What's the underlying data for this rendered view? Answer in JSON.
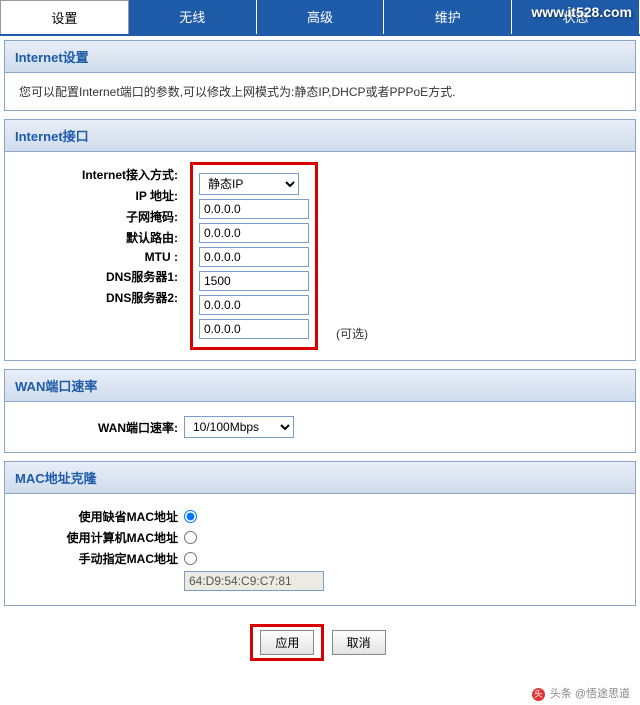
{
  "watermark": "www.it528.com",
  "tabs": {
    "settings": "设置",
    "wireless": "无线",
    "advanced": "高级",
    "maintenance": "维护",
    "status": "状态"
  },
  "internet_settings": {
    "title": "Internet设置",
    "help": "您可以配置Internet端口的参数,可以修改上网模式为:静态IP,DHCP或者PPPoE方式."
  },
  "internet_interface": {
    "title": "Internet接口",
    "labels": {
      "mode": "Internet接入方式:",
      "ip": "IP 地址:",
      "mask": "子网掩码:",
      "gateway": "默认路由:",
      "mtu": "MTU :",
      "dns1": "DNS服务器1:",
      "dns2": "DNS服务器2:"
    },
    "values": {
      "mode": "静态IP",
      "ip": "0.0.0.0",
      "mask": "0.0.0.0",
      "gateway": "0.0.0.0",
      "mtu": "1500",
      "dns1": "0.0.0.0",
      "dns2": "0.0.0.0"
    },
    "hint_optional": "(可选)"
  },
  "wan_speed": {
    "title": "WAN端口速率",
    "label": "WAN端口速率:",
    "value": "10/100Mbps"
  },
  "mac_clone": {
    "title": "MAC地址克隆",
    "options": {
      "default": "使用缺省MAC地址",
      "pc": "使用计算机MAC地址",
      "manual": "手动指定MAC地址"
    },
    "mac_value": "64:D9:54:C9:C7:81"
  },
  "buttons": {
    "apply": "应用",
    "cancel": "取消"
  },
  "footer": {
    "prefix": "头条 @",
    "name": "悟途思道"
  }
}
